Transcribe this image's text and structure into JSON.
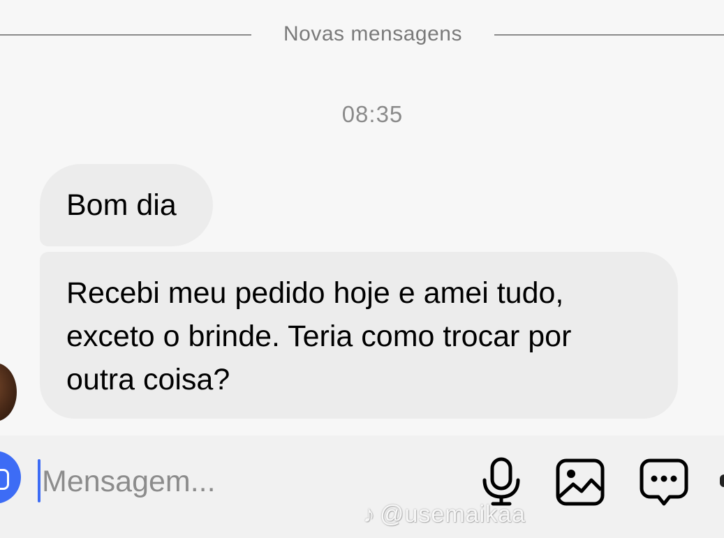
{
  "divider": {
    "label": "Novas mensagens"
  },
  "thread": {
    "timestamp": "08:35",
    "messages": [
      {
        "text": "Bom dia"
      },
      {
        "text": "Recebi meu pedido hoje e amei tudo,\nexceto o brinde. Teria como trocar por\noutra coisa?"
      }
    ]
  },
  "composer": {
    "placeholder": "Mensagem...",
    "value": "",
    "icons": [
      "camera-icon",
      "microphone-icon",
      "gallery-icon",
      "sticker-icon"
    ],
    "accent_color": "#3d6cf5"
  },
  "watermark": {
    "text": "@usemaikaa",
    "icon": "tiktok-icon"
  }
}
